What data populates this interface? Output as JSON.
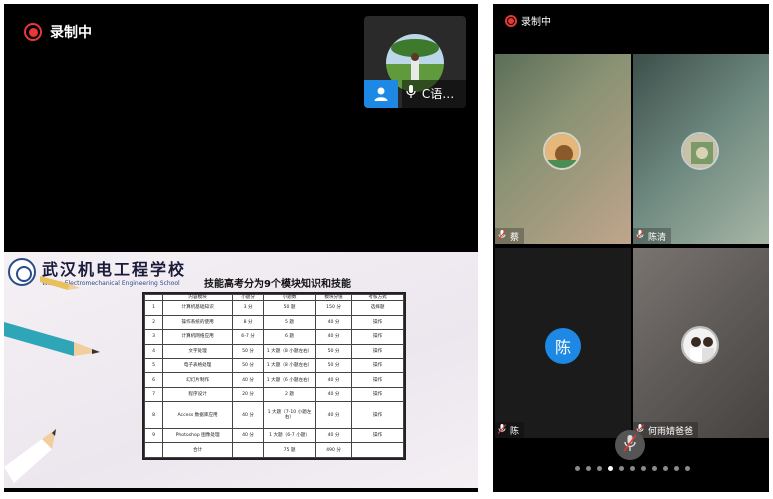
{
  "main_view": {
    "recording_label": "录制中",
    "thumbnail": {
      "name": "C语…"
    },
    "slide": {
      "school_cn": "武汉机电工程学校",
      "school_en": "Wuhan Electromechanical Engineering School",
      "title": "技能高考分为9个模块知识和技能",
      "table": {
        "headers": [
          "",
          "内容模块",
          "小题分",
          "小题数",
          "模块分值",
          "考核方式"
        ],
        "rows": [
          [
            "1",
            "计算机基础知识",
            "3 分",
            "50 题",
            "150 分",
            "选择题"
          ],
          [
            "2",
            "操作系统的使用",
            "8 分",
            "5 题",
            "40 分",
            "操作"
          ],
          [
            "3",
            "计算机网络应用",
            "6-7 分",
            "6 题",
            "40 分",
            "操作"
          ],
          [
            "4",
            "文字处理",
            "50 分",
            "1 大题（8 小题左右）",
            "50 分",
            "操作"
          ],
          [
            "5",
            "电子表格处理",
            "50 分",
            "1 大题（8 小题左右）",
            "50 分",
            "操作"
          ],
          [
            "6",
            "幻灯片制作",
            "40 分",
            "1 大题（6 小题左右）",
            "40 分",
            "操作"
          ],
          [
            "7",
            "程序设计",
            "20 分",
            "2 题",
            "40 分",
            "操作"
          ],
          [
            "8",
            "Access 数据库应用",
            "40 分",
            "1 大题（7-10 小题左右）",
            "40 分",
            "操作"
          ],
          [
            "9",
            "Photoshop 图像处理",
            "40 分",
            "1 大题（6-7 小题）",
            "40 分",
            "操作"
          ]
        ],
        "total": [
          "",
          "合计",
          "",
          "75 题",
          "490 分",
          ""
        ]
      }
    }
  },
  "gallery": {
    "recording_label": "录制中",
    "participants": [
      {
        "name": "蔡"
      },
      {
        "name": "陈清"
      },
      {
        "name": "陈",
        "initial": "陈"
      },
      {
        "name": "何雨婧爸爸"
      }
    ],
    "page_count": 11,
    "active_page": 3
  },
  "colors": {
    "record_red": "#e53935",
    "accent_blue": "#1e88e5"
  },
  "icons": [
    "record-icon",
    "person-icon",
    "mic-icon",
    "mic-muted-icon",
    "school-logo"
  ]
}
